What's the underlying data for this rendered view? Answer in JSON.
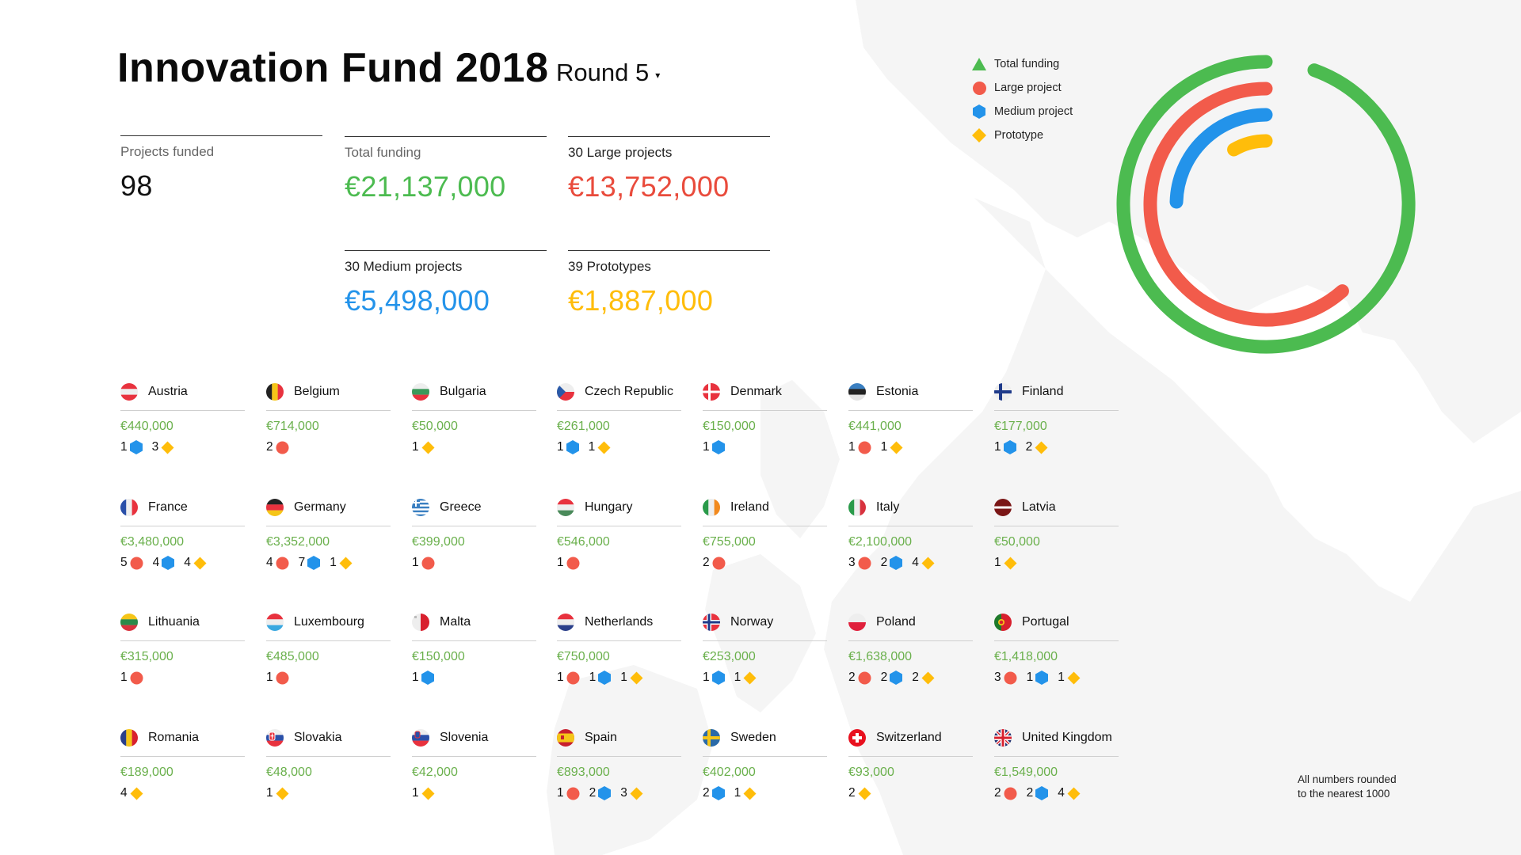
{
  "header": {
    "title": "Innovation Fund 2018",
    "round_selector": {
      "label": "Round 5",
      "caret": "▾"
    }
  },
  "colors": {
    "total": "#4cbb50",
    "large": "#f25b4b",
    "medium": "#2393ea",
    "prototype": "#ffbd0a",
    "country_amount": "#6ab04c"
  },
  "stats": {
    "projects_funded": {
      "label": "Projects funded",
      "value": "98"
    },
    "total_funding": {
      "label": "Total funding",
      "value": "€21,137,000"
    },
    "large": {
      "label": "30 Large projects",
      "value": "€13,752,000"
    },
    "medium": {
      "label": "30 Medium projects",
      "value": "€5,498,000"
    },
    "prototype": {
      "label": "39 Prototypes",
      "value": "€1,887,000"
    }
  },
  "legend": [
    {
      "key": "total",
      "label": "Total funding",
      "icon": "triangle-icon"
    },
    {
      "key": "large",
      "label": "Large project",
      "icon": "circle-icon"
    },
    {
      "key": "medium",
      "label": "Medium project",
      "icon": "hexagon-icon"
    },
    {
      "key": "prototype",
      "label": "Prototype",
      "icon": "diamond-icon"
    }
  ],
  "chart_data": {
    "type": "radial-bar",
    "title": "",
    "legend_position": "top-left",
    "series": [
      {
        "name": "Total funding",
        "key": "total",
        "value": 21137000
      },
      {
        "name": "Large project",
        "key": "large",
        "value": 13752000
      },
      {
        "name": "Medium project",
        "key": "medium",
        "value": 5498000
      },
      {
        "name": "Prototype",
        "key": "prototype",
        "value": 1887000
      }
    ],
    "max_fraction_of_circle": 0.945
  },
  "countries": [
    {
      "name": "Austria",
      "flag": "at",
      "amount": "€440,000",
      "counts": [
        {
          "type": "medium",
          "n": "1"
        },
        {
          "type": "prototype",
          "n": "3"
        }
      ]
    },
    {
      "name": "Belgium",
      "flag": "be",
      "amount": "€714,000",
      "counts": [
        {
          "type": "large",
          "n": "2"
        }
      ]
    },
    {
      "name": "Bulgaria",
      "flag": "bg",
      "amount": "€50,000",
      "counts": [
        {
          "type": "prototype",
          "n": "1"
        }
      ]
    },
    {
      "name": "Czech Republic",
      "flag": "cz",
      "amount": "€261,000",
      "counts": [
        {
          "type": "medium",
          "n": "1"
        },
        {
          "type": "prototype",
          "n": "1"
        }
      ]
    },
    {
      "name": "Denmark",
      "flag": "dk",
      "amount": "€150,000",
      "counts": [
        {
          "type": "medium",
          "n": "1"
        }
      ]
    },
    {
      "name": "Estonia",
      "flag": "ee",
      "amount": "€441,000",
      "counts": [
        {
          "type": "large",
          "n": "1"
        },
        {
          "type": "prototype",
          "n": "1"
        }
      ]
    },
    {
      "name": "Finland",
      "flag": "fi",
      "amount": "€177,000",
      "counts": [
        {
          "type": "medium",
          "n": "1"
        },
        {
          "type": "prototype",
          "n": "2"
        }
      ]
    },
    {
      "name": "France",
      "flag": "fr",
      "amount": "€3,480,000",
      "counts": [
        {
          "type": "large",
          "n": "5"
        },
        {
          "type": "medium",
          "n": "4"
        },
        {
          "type": "prototype",
          "n": "4"
        }
      ]
    },
    {
      "name": "Germany",
      "flag": "de",
      "amount": "€3,352,000",
      "counts": [
        {
          "type": "large",
          "n": "4"
        },
        {
          "type": "medium",
          "n": "7"
        },
        {
          "type": "prototype",
          "n": "1"
        }
      ]
    },
    {
      "name": "Greece",
      "flag": "gr",
      "amount": "€399,000",
      "counts": [
        {
          "type": "large",
          "n": "1"
        }
      ]
    },
    {
      "name": "Hungary",
      "flag": "hu",
      "amount": "€546,000",
      "counts": [
        {
          "type": "large",
          "n": "1"
        }
      ]
    },
    {
      "name": "Ireland",
      "flag": "ie",
      "amount": "€755,000",
      "counts": [
        {
          "type": "large",
          "n": "2"
        }
      ]
    },
    {
      "name": "Italy",
      "flag": "it",
      "amount": "€2,100,000",
      "counts": [
        {
          "type": "large",
          "n": "3"
        },
        {
          "type": "medium",
          "n": "2"
        },
        {
          "type": "prototype",
          "n": "4"
        }
      ]
    },
    {
      "name": "Latvia",
      "flag": "lv",
      "amount": "€50,000",
      "counts": [
        {
          "type": "prototype",
          "n": "1"
        }
      ]
    },
    {
      "name": "Lithuania",
      "flag": "lt",
      "amount": "€315,000",
      "counts": [
        {
          "type": "large",
          "n": "1"
        }
      ]
    },
    {
      "name": "Luxembourg",
      "flag": "lu",
      "amount": "€485,000",
      "counts": [
        {
          "type": "large",
          "n": "1"
        }
      ]
    },
    {
      "name": "Malta",
      "flag": "mt",
      "amount": "€150,000",
      "counts": [
        {
          "type": "medium",
          "n": "1"
        }
      ]
    },
    {
      "name": "Netherlands",
      "flag": "nl",
      "amount": "€750,000",
      "counts": [
        {
          "type": "large",
          "n": "1"
        },
        {
          "type": "medium",
          "n": "1"
        },
        {
          "type": "prototype",
          "n": "1"
        }
      ]
    },
    {
      "name": "Norway",
      "flag": "no",
      "amount": "€253,000",
      "counts": [
        {
          "type": "medium",
          "n": "1"
        },
        {
          "type": "prototype",
          "n": "1"
        }
      ]
    },
    {
      "name": "Poland",
      "flag": "pl",
      "amount": "€1,638,000",
      "counts": [
        {
          "type": "large",
          "n": "2"
        },
        {
          "type": "medium",
          "n": "2"
        },
        {
          "type": "prototype",
          "n": "2"
        }
      ]
    },
    {
      "name": "Portugal",
      "flag": "pt",
      "amount": "€1,418,000",
      "counts": [
        {
          "type": "large",
          "n": "3"
        },
        {
          "type": "medium",
          "n": "1"
        },
        {
          "type": "prototype",
          "n": "1"
        }
      ]
    },
    {
      "name": "Romania",
      "flag": "ro",
      "amount": "€189,000",
      "counts": [
        {
          "type": "prototype",
          "n": "4"
        }
      ]
    },
    {
      "name": "Slovakia",
      "flag": "sk",
      "amount": "€48,000",
      "counts": [
        {
          "type": "prototype",
          "n": "1"
        }
      ]
    },
    {
      "name": "Slovenia",
      "flag": "si",
      "amount": "€42,000",
      "counts": [
        {
          "type": "prototype",
          "n": "1"
        }
      ]
    },
    {
      "name": "Spain",
      "flag": "es",
      "amount": "€893,000",
      "counts": [
        {
          "type": "large",
          "n": "1"
        },
        {
          "type": "medium",
          "n": "2"
        },
        {
          "type": "prototype",
          "n": "3"
        }
      ]
    },
    {
      "name": "Sweden",
      "flag": "se",
      "amount": "€402,000",
      "counts": [
        {
          "type": "medium",
          "n": "2"
        },
        {
          "type": "prototype",
          "n": "1"
        }
      ]
    },
    {
      "name": "Switzerland",
      "flag": "ch",
      "amount": "€93,000",
      "counts": [
        {
          "type": "prototype",
          "n": "2"
        }
      ]
    },
    {
      "name": "United Kingdom",
      "flag": "gb",
      "amount": "€1,549,000",
      "counts": [
        {
          "type": "large",
          "n": "2"
        },
        {
          "type": "medium",
          "n": "2"
        },
        {
          "type": "prototype",
          "n": "4"
        }
      ]
    }
  ],
  "footnote": {
    "line1": "All numbers rounded",
    "line2": "to the nearest 1000"
  }
}
